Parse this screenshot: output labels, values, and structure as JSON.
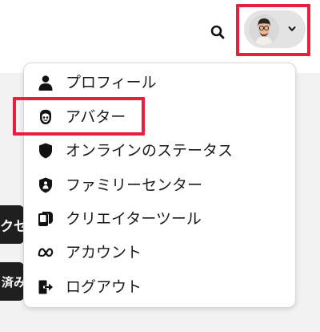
{
  "header": {
    "search_icon": "search-icon",
    "avatar_icon": "avatar-portrait",
    "dropdown_icon": "chevron-down-icon"
  },
  "background_buttons": [
    {
      "label": "クセ"
    },
    {
      "label": "済み"
    }
  ],
  "menu": {
    "items": [
      {
        "label": "プロフィール",
        "icon": "person-icon"
      },
      {
        "label": "アバター",
        "icon": "avatar-icon"
      },
      {
        "label": "オンラインのステータス",
        "icon": "shield-icon"
      },
      {
        "label": "ファミリーセンター",
        "icon": "family-shield-icon"
      },
      {
        "label": "クリエイターツール",
        "icon": "creator-tools-icon"
      },
      {
        "label": "アカウント",
        "icon": "meta-icon"
      },
      {
        "label": "ログアウト",
        "icon": "logout-icon"
      }
    ]
  },
  "colors": {
    "highlight": "#e8203f",
    "background": "#f2f2f2",
    "menu_background": "#ffffff",
    "text": "#1a1a1a"
  }
}
